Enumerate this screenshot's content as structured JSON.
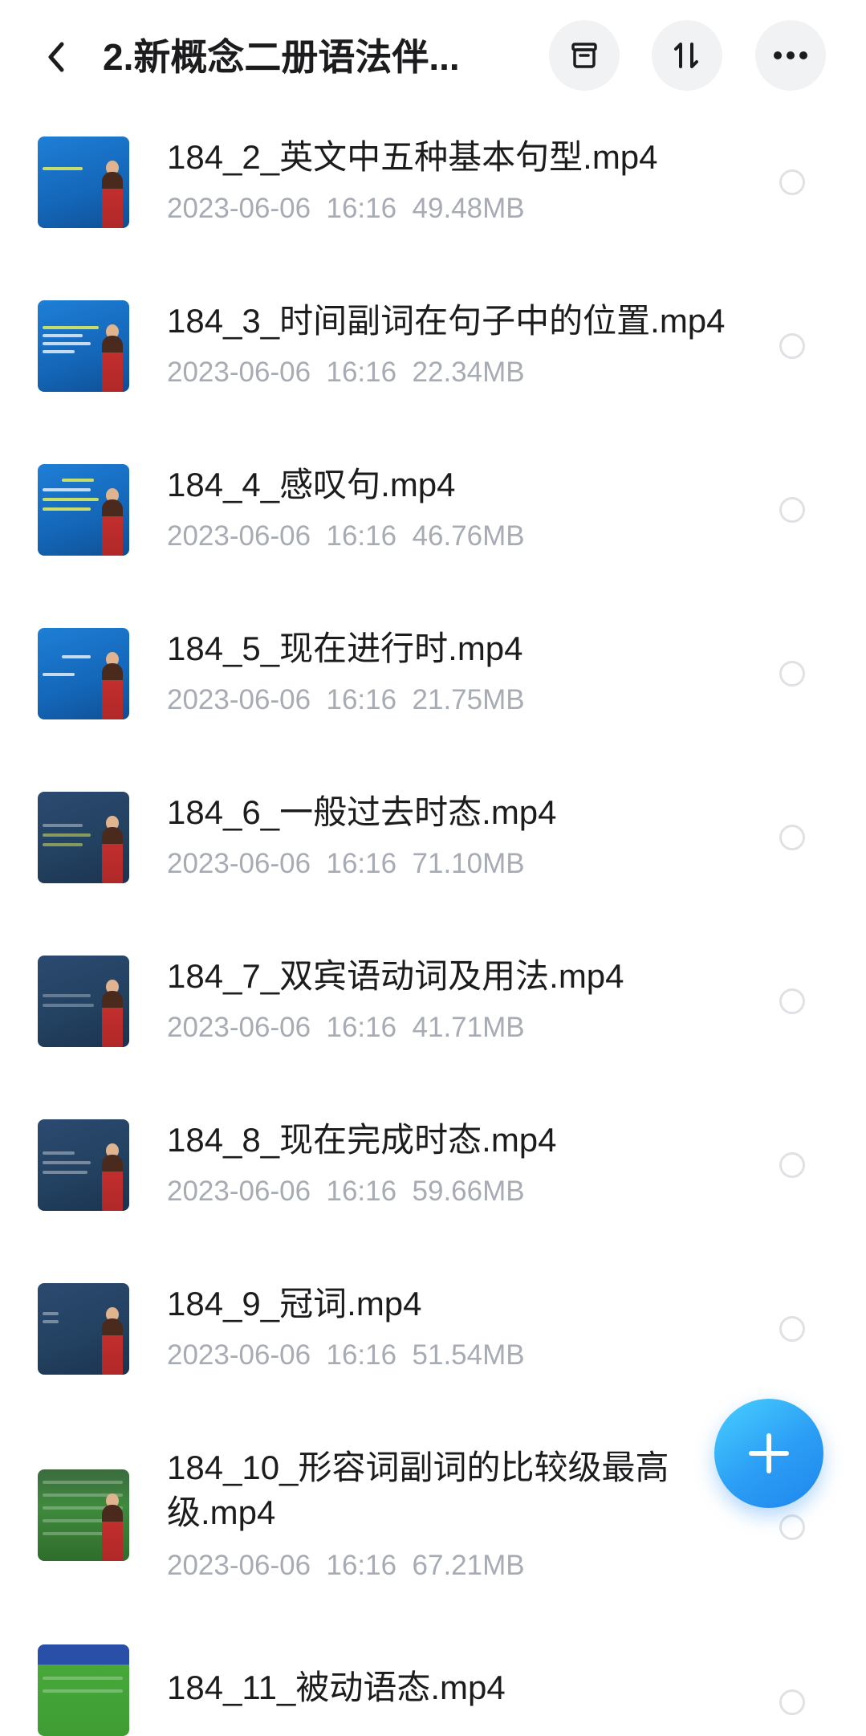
{
  "header": {
    "title": "2.新概念二册语法伴...",
    "icons": {
      "back": "chevron-left-icon",
      "archive": "archive-box-icon",
      "sort": "sort-arrows-icon",
      "more": "more-dots-icon"
    }
  },
  "files": [
    {
      "name": "184_2_英文中五种基本句型.mp4",
      "meta": "2023-06-06  16:16  49.48MB"
    },
    {
      "name": "184_3_时间副词在句子中的位置.mp4",
      "meta": "2023-06-06  16:16  22.34MB"
    },
    {
      "name": "184_4_感叹句.mp4",
      "meta": "2023-06-06  16:16  46.76MB"
    },
    {
      "name": "184_5_现在进行时.mp4",
      "meta": "2023-06-06  16:16  21.75MB"
    },
    {
      "name": "184_6_一般过去时态.mp4",
      "meta": "2023-06-06  16:16  71.10MB"
    },
    {
      "name": "184_7_双宾语动词及用法.mp4",
      "meta": "2023-06-06  16:16  41.71MB"
    },
    {
      "name": "184_8_现在完成时态.mp4",
      "meta": "2023-06-06  16:16  59.66MB"
    },
    {
      "name": "184_9_冠词.mp4",
      "meta": "2023-06-06  16:16  51.54MB"
    },
    {
      "name": "184_10_形容词副词的比较级最高级.mp4",
      "meta": "2023-06-06  16:16  67.21MB"
    },
    {
      "name": "184_11_被动语态.mp4",
      "meta": ""
    }
  ],
  "fab": {
    "icon": "plus-icon"
  },
  "colors": {
    "fab": "#2b9df5",
    "meta_text": "#a7abb3",
    "title_text": "#1c1c1e"
  }
}
